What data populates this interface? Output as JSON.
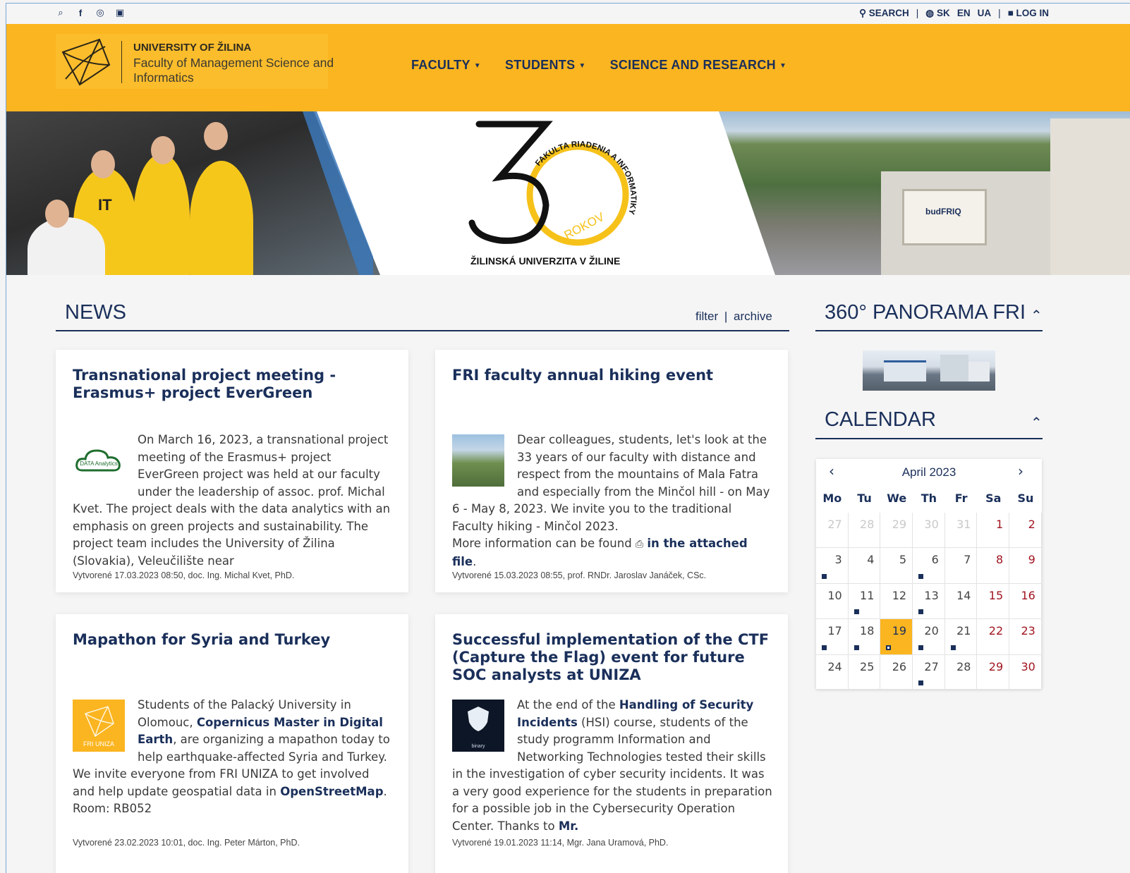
{
  "topbar": {
    "social_icons": [
      "rss-icon",
      "facebook-icon",
      "instagram-icon",
      "gallery-icon"
    ],
    "search": "SEARCH",
    "lang_sk": "SK",
    "lang_en": "EN",
    "lang_ua": "UA",
    "login": "LOG IN"
  },
  "header": {
    "university": "UNIVERSITY OF ŽILINA",
    "faculty": "Faculty of Management Science and Informatics",
    "nav": [
      "FACULTY",
      "STUDENTS",
      "SCIENCE AND RESEARCH"
    ],
    "brand_color": "#fbb520",
    "navy": "#1a2f5a"
  },
  "banner": {
    "logo_number": "30",
    "logo_ring_text": "FAKULTA RIADENIA A INFORMATIKY",
    "logo_rokov": "ROKOV",
    "logo_caption": "ŽILINSKÁ UNIVERZITA V ŽILINE",
    "shirt_text": "IT",
    "building_sign": "budFRIQ"
  },
  "news": {
    "title": "NEWS",
    "filter": "filter",
    "sep": "|",
    "archive": "archive",
    "cards": [
      {
        "title": "Transnational project meeting - Erasmus+ project EverGreen",
        "thumb_label": "DATA Analytics",
        "body": "On March 16, 2023, a transnational project meeting of the Erasmus+ project EverGreen project was held at our faculty under the leadership of assoc. prof. Michal Kvet. The project deals with the data analytics with an emphasis on green projects and sustainability. The project team includes the University of Žilina (Slovakia), Veleučilište near",
        "meta": "Vytvorené 17.03.2023 08:50, doc. Ing. Michal Kvet, PhD."
      },
      {
        "title": "FRI faculty annual hiking event",
        "body": "Dear colleagues, students, let's look at the 33 years of our faculty with distance and respect from the mountains of Mala Fatra and especially from the Minčol hill - on May 6 - May 8, 2023. We invite you to the traditional Faculty hiking - Minčol 2023.",
        "more_prefix": "More information can be found",
        "more_link": "in the attached file",
        "more_suffix": ".",
        "meta": "Vytvorené 15.03.2023 08:55, prof. RNDr. Jaroslav Janáček, CSc."
      },
      {
        "title": "Mapathon for Syria and Turkey",
        "thumb_label": "FRI UNIZA",
        "body_a": "Students of the Palacký University in Olomouc, ",
        "link_a": "Copernicus Master in Digital Earth",
        "body_b": ", are organizing a mapathon today to help earthquake-affected Syria and Turkey.",
        "body_c": "We invite everyone from FRI UNIZA to get involved and help update geospatial data in ",
        "link_b": "OpenStreetMap",
        "body_d": ".",
        "body_e": "Room: RB052",
        "meta": "Vytvorené 23.02.2023 10:01, doc. Ing. Peter Márton, PhD."
      },
      {
        "title": "Successful implementation of the CTF (Capture the Flag) event for future SOC analysts at UNIZA",
        "thumb_label": "binary",
        "body_a": "At the end of the ",
        "link_a": "Handling of Security Incidents",
        "body_b": " (HSI) course, students of the study programm Information and Networking Technologies tested their skills in the investigation of cyber security incidents. It was a very good experience for the students in preparation for a possible job in the Cybersecurity Operation Center. Thanks to ",
        "link_b": "Mr.",
        "meta": "Vytvorené 19.01.2023 11:14, Mgr. Jana Uramová, PhD."
      }
    ]
  },
  "sidebar": {
    "panorama_title": "360° PANORAMA FRI",
    "calendar_title": "CALENDAR",
    "caret": "^"
  },
  "calendar": {
    "month": "April 2023",
    "prev": "<",
    "next": ">",
    "dows": [
      "Mo",
      "Tu",
      "We",
      "Th",
      "Fr",
      "Sa",
      "Su"
    ],
    "weeks": [
      [
        {
          "d": "27",
          "o": true
        },
        {
          "d": "28",
          "o": true
        },
        {
          "d": "29",
          "o": true
        },
        {
          "d": "30",
          "o": true
        },
        {
          "d": "31",
          "o": true
        },
        {
          "d": "1",
          "w": true
        },
        {
          "d": "2",
          "w": true
        }
      ],
      [
        {
          "d": "3",
          "e": true
        },
        {
          "d": "4"
        },
        {
          "d": "5"
        },
        {
          "d": "6",
          "e": true
        },
        {
          "d": "7"
        },
        {
          "d": "8",
          "w": true
        },
        {
          "d": "9",
          "w": true
        }
      ],
      [
        {
          "d": "10"
        },
        {
          "d": "11",
          "e": true
        },
        {
          "d": "12"
        },
        {
          "d": "13",
          "e": true
        },
        {
          "d": "14"
        },
        {
          "d": "15",
          "w": true
        },
        {
          "d": "16",
          "w": true
        }
      ],
      [
        {
          "d": "17",
          "e": true
        },
        {
          "d": "18",
          "e": true
        },
        {
          "d": "19",
          "t": true,
          "e": true
        },
        {
          "d": "20",
          "e": true
        },
        {
          "d": "21",
          "e": true
        },
        {
          "d": "22",
          "w": true
        },
        {
          "d": "23",
          "w": true
        }
      ],
      [
        {
          "d": "24"
        },
        {
          "d": "25"
        },
        {
          "d": "26"
        },
        {
          "d": "27",
          "e": true
        },
        {
          "d": "28"
        },
        {
          "d": "29",
          "w": true
        },
        {
          "d": "30",
          "w": true
        }
      ]
    ]
  }
}
